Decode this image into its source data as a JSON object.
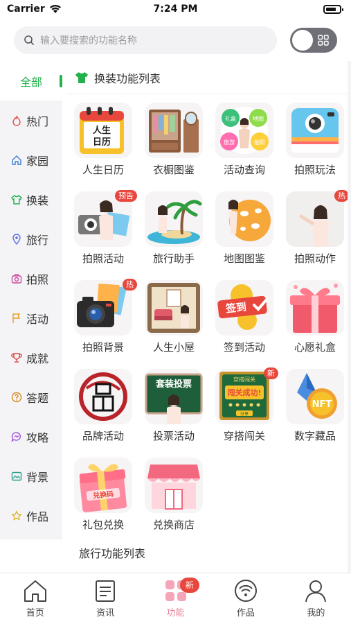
{
  "status_bar": {
    "carrier": "Carrier",
    "time": "7:24 PM"
  },
  "search": {
    "placeholder": "输入要搜索的功能名称"
  },
  "sidebar": {
    "items": [
      {
        "label": "全部",
        "icon": "all-icon",
        "active": true
      },
      {
        "label": "热门",
        "icon": "flame-icon"
      },
      {
        "label": "家园",
        "icon": "home-icon"
      },
      {
        "label": "换装",
        "icon": "shirt-icon"
      },
      {
        "label": "旅行",
        "icon": "location-icon"
      },
      {
        "label": "拍照",
        "icon": "camera-icon"
      },
      {
        "label": "活动",
        "icon": "flag-icon"
      },
      {
        "label": "成就",
        "icon": "trophy-icon"
      },
      {
        "label": "答题",
        "icon": "question-icon"
      },
      {
        "label": "攻略",
        "icon": "chat-icon"
      },
      {
        "label": "背景",
        "icon": "picture-icon"
      },
      {
        "label": "作品",
        "icon": "star-icon"
      }
    ]
  },
  "main": {
    "section_title": "换装功能列表",
    "features": [
      {
        "label": "人生日历",
        "icon": "calendar-icon"
      },
      {
        "label": "衣橱图鉴",
        "icon": "wardrobe-icon"
      },
      {
        "label": "活动查询",
        "icon": "activity-query-icon"
      },
      {
        "label": "拍照玩法",
        "icon": "instant-camera-icon"
      },
      {
        "label": "拍照活动",
        "icon": "photo-activity-icon",
        "badge": "预告"
      },
      {
        "label": "旅行助手",
        "icon": "palm-tree-icon"
      },
      {
        "label": "地图图鉴",
        "icon": "map-globe-icon"
      },
      {
        "label": "拍照动作",
        "icon": "photo-pose-icon",
        "badge": "热"
      },
      {
        "label": "拍照背景",
        "icon": "dslr-camera-icon",
        "badge": "热"
      },
      {
        "label": "人生小屋",
        "icon": "house-room-icon"
      },
      {
        "label": "签到活动",
        "icon": "sign-in-icon"
      },
      {
        "label": "心愿礼盒",
        "icon": "gift-box-icon"
      },
      {
        "label": "品牌活动",
        "icon": "brand-seal-icon"
      },
      {
        "label": "投票活动",
        "icon": "vote-board-icon"
      },
      {
        "label": "穿搭闯关",
        "icon": "challenge-board-icon",
        "badge": "新"
      },
      {
        "label": "数字藏品",
        "icon": "nft-icon"
      },
      {
        "label": "礼包兑换",
        "icon": "gift-pack-icon"
      },
      {
        "label": "兑换商店",
        "icon": "shop-icon"
      }
    ],
    "icon_texts": {
      "calendar": "人生\n日历",
      "activity_tags": [
        "礼盒",
        "地图",
        "旅游",
        "拍照"
      ],
      "sign_in": "签到",
      "vote": "套装投票",
      "challenge_title": "穿搭闯关",
      "challenge_main": "闯关成功!",
      "challenge_sub": "分享",
      "nft": "NFT",
      "gift_pack": "兑换码"
    },
    "sub_section_title": "旅行功能列表"
  },
  "tabbar": {
    "tabs": [
      {
        "label": "首页",
        "icon": "home-tab-icon"
      },
      {
        "label": "资讯",
        "icon": "news-tab-icon"
      },
      {
        "label": "功能",
        "icon": "features-tab-icon",
        "active": true,
        "badge": "新"
      },
      {
        "label": "作品",
        "icon": "works-tab-icon"
      },
      {
        "label": "我的",
        "icon": "profile-tab-icon"
      }
    ]
  },
  "colors": {
    "accent_green": "#22b14c",
    "accent_pink": "#e97f9a",
    "badge_red": "#e8473d"
  }
}
